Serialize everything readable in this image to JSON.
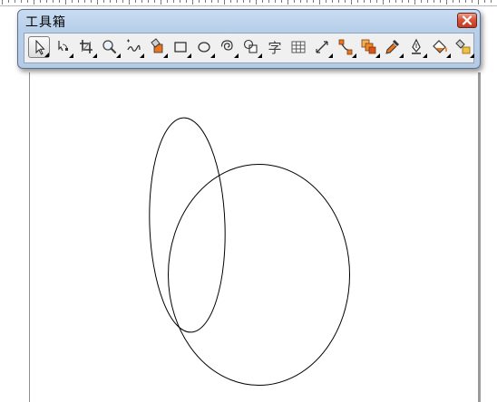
{
  "toolbox": {
    "title": "工具箱",
    "tools": [
      {
        "name": "pick-tool",
        "icon": "pointer-arrow-icon",
        "selected": true
      },
      {
        "name": "shape-tool",
        "icon": "shape-node-icon"
      },
      {
        "name": "crop-tool",
        "icon": "crop-icon"
      },
      {
        "name": "zoom-tool",
        "icon": "magnifier-icon"
      },
      {
        "name": "freehand-tool",
        "icon": "freehand-curve-icon"
      },
      {
        "name": "smart-fill-tool",
        "icon": "smart-fill-icon"
      },
      {
        "name": "rectangle-tool",
        "icon": "rectangle-icon"
      },
      {
        "name": "ellipse-tool",
        "icon": "ellipse-icon"
      },
      {
        "name": "spiral-tool",
        "icon": "spiral-icon"
      },
      {
        "name": "basic-shapes-tool",
        "icon": "basic-shapes-icon"
      },
      {
        "name": "text-tool",
        "icon": "text-glyph-icon",
        "glyph": "字"
      },
      {
        "name": "table-tool",
        "icon": "table-grid-icon"
      },
      {
        "name": "dimension-tool",
        "icon": "dimension-icon"
      },
      {
        "name": "connector-tool",
        "icon": "connector-icon"
      },
      {
        "name": "blend-tool",
        "icon": "blend-icon"
      },
      {
        "name": "eyedropper-tool",
        "icon": "eyedropper-icon"
      },
      {
        "name": "outline-pen-tool",
        "icon": "pen-nib-icon"
      },
      {
        "name": "fill-tool",
        "icon": "paint-bucket-icon"
      },
      {
        "name": "interactive-fill-tool",
        "icon": "interactive-fill-icon"
      }
    ]
  },
  "colors": {
    "close_button": "#c9462c",
    "accent_orange": "#e8761e",
    "stroke": "#000000"
  }
}
